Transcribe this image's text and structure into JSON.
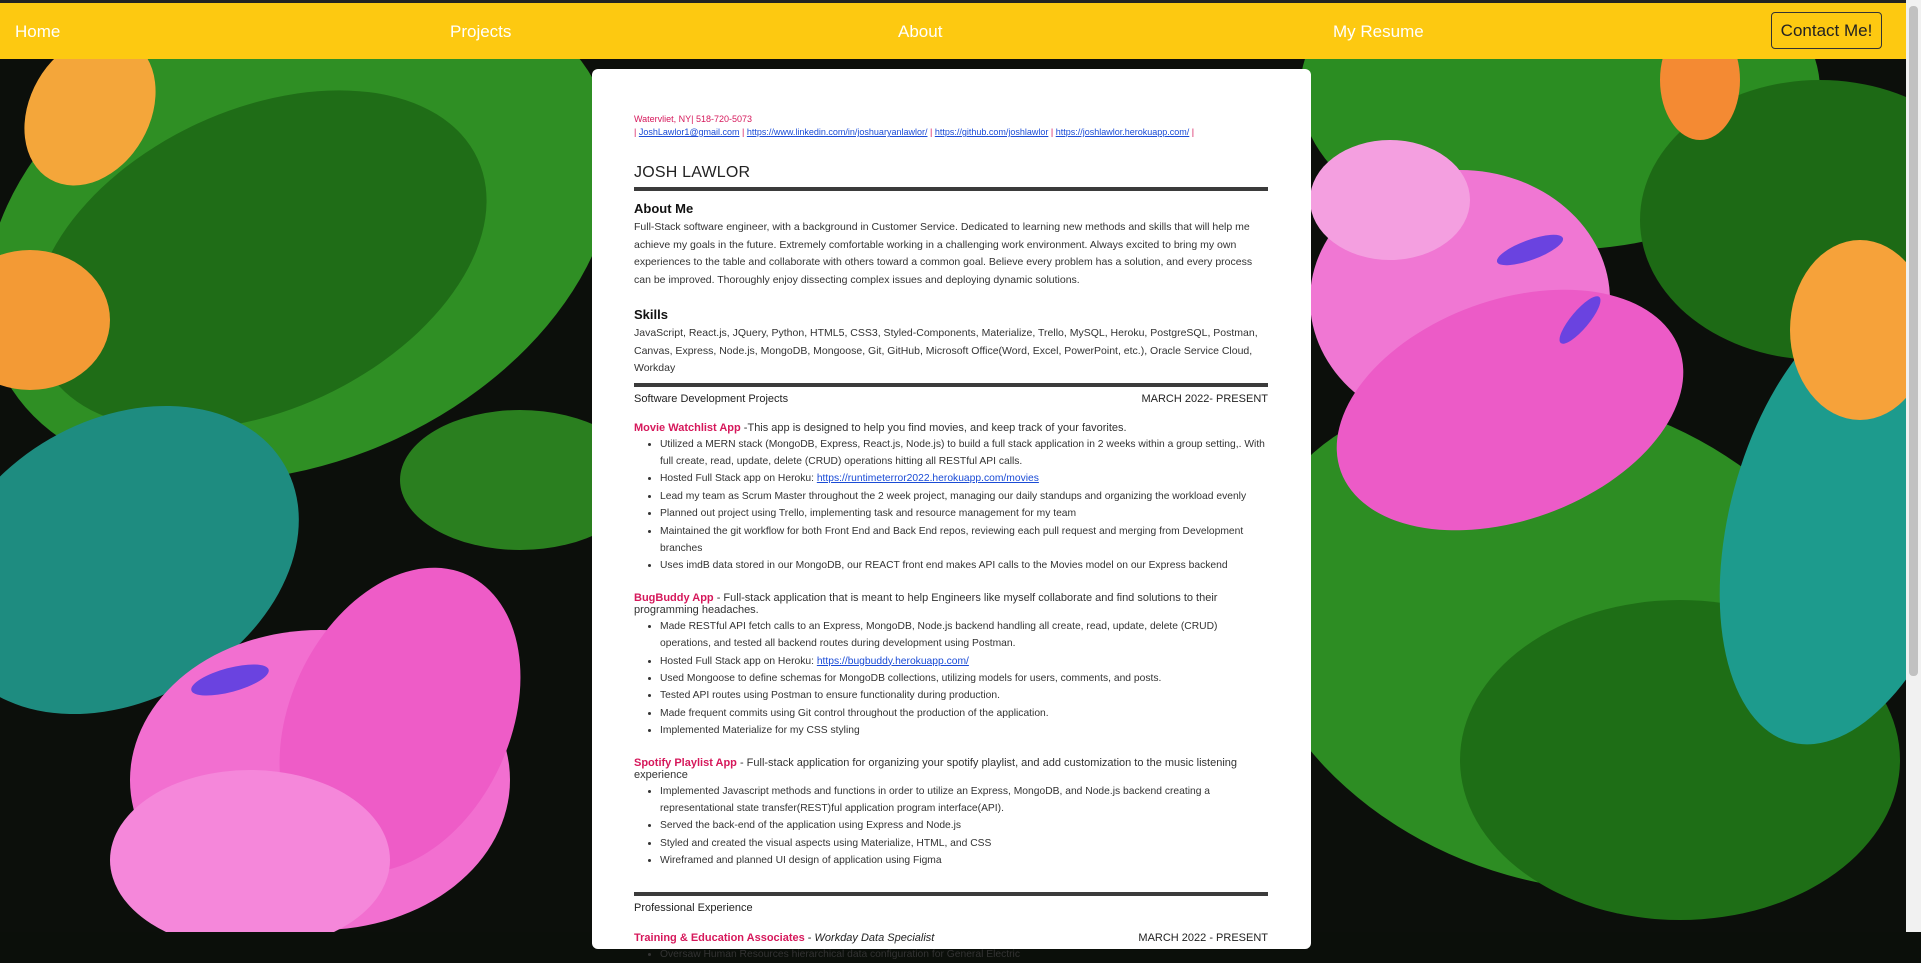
{
  "nav": {
    "home": "Home",
    "projects": "Projects",
    "about": "About",
    "resume": "My Resume",
    "contact": "Contact Me!"
  },
  "resume": {
    "location": "Watervliet, NY| 518-720-5073",
    "links": {
      "email": "JoshLawlor1@gmail.com",
      "linkedin": "https://www.linkedin.com/in/joshuaryanlawlor/",
      "github": "https://github.com/joshlawlor",
      "site": "https://joshlawlor.herokuapp.com/"
    },
    "name": "JOSH LAWLOR",
    "about_title": "About Me",
    "about_text": "Full-Stack software engineer, with a background in Customer Service. Dedicated to learning new methods and skills that will help me achieve my goals in the future. Extremely comfortable working in a challenging work environment. Always excited to bring my own experiences to the table and collaborate with others toward a common goal. Believe every problem has a solution, and every process can be improved. Thoroughly enjoy dissecting complex issues and deploying dynamic solutions.",
    "skills_title": "Skills",
    "skills_text": "JavaScript, React.js, JQuery, Python, HTML5, CSS3, Styled-Components, Materialize, Trello, MySQL, Heroku, PostgreSQL, Postman, Canvas, Express, Node.js, MongoDB, Mongoose, Git, GitHub, Microsoft Office(Word, Excel, PowerPoint, etc.), Oracle Service Cloud, Workday",
    "projects_title": "Software Development Projects",
    "projects_date": "MARCH 2022- PRESENT",
    "projects": [
      {
        "name": "Movie Watchlist App",
        "desc": " -This app is designed to help you find movies, and keep track of your favorites.",
        "bullets": [
          "Utilized a MERN stack (MongoDB, Express, React.js, Node.js) to build a full stack application in 2 weeks within a group setting,. With full create, read, update, delete (CRUD) operations hitting all RESTful API calls.",
          "Hosted Full Stack app on Heroku: ",
          "Lead my team as Scrum Master throughout the 2 week project, managing our daily standups and organizing the workload evenly",
          "Planned out project using Trello, implementing task and resource management for my team",
          "Maintained the git workflow for both Front End and Back End repos, reviewing each pull request and merging from Development branches",
          "Uses imdB data stored in our MongoDB, our REACT front end makes API calls to the Movies model on our Express backend"
        ],
        "link": "https://runtimeterror2022.herokuapp.com/movies"
      },
      {
        "name": "BugBuddy App",
        "desc": " - Full-stack application that is meant to help Engineers like myself collaborate and find solutions to their programming headaches.",
        "bullets": [
          "Made RESTful API fetch calls to an Express, MongoDB, Node.js backend handling all create, read, update, delete (CRUD) operations, and tested all backend routes during development using Postman.",
          "Hosted Full Stack app on Heroku: ",
          "Used Mongoose to define schemas for MongoDB collections, utilizing models for users, comments, and posts.",
          "Tested API routes using Postman to ensure functionality during production.",
          "Made frequent commits using Git control throughout the production of the application.",
          "Implemented Materialize for my CSS styling"
        ],
        "link": "https://bugbuddy.herokuapp.com/"
      },
      {
        "name": "Spotify Playlist App",
        "desc": " - Full-stack application for organizing your spotify playlist, and add customization to the music listening experience",
        "bullets": [
          "Implemented Javascript methods and functions in order to utilize an Express, MongoDB, and Node.js backend creating a representational state transfer(REST)ful application program interface(API).",
          "Served the back-end of the application using Express and Node.js",
          "Styled and created the visual aspects using Materialize, HTML, and CSS",
          "Wireframed and planned UI design of application using Figma"
        ]
      }
    ],
    "experience_title": "Professional Experience",
    "job": {
      "company": "Training & Education Associates",
      "sep": " - ",
      "role": "Workday Data Specialist",
      "date": "MARCH 2022 - PRESENT",
      "bullets": [
        "Oversaw Human Resources hierarchical data configuration for General Electric"
      ]
    }
  }
}
